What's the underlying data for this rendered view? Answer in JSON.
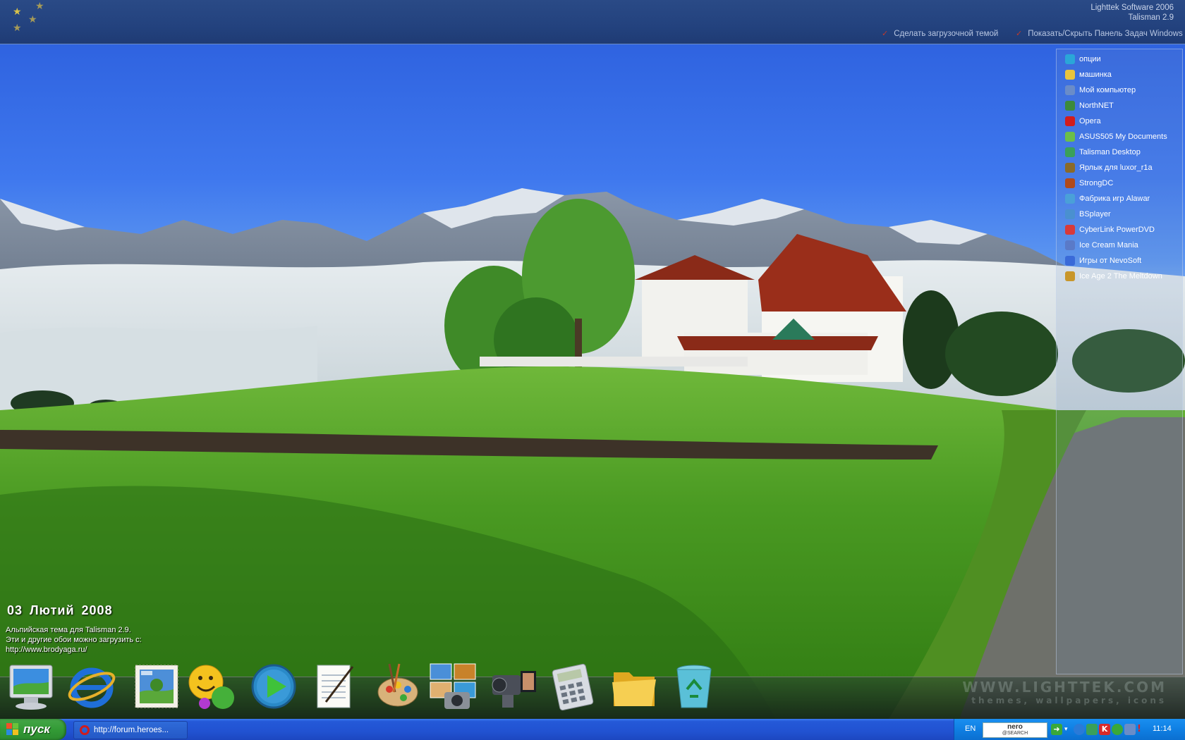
{
  "top_bar": {
    "brand_line1": "Lighttek Software 2006",
    "brand_line2": "Talisman 2.9",
    "link_boot_theme": "Сделать загрузочной темой",
    "link_toggle_taskbar": "Показать/Скрыть Панель Задач Windows"
  },
  "side_panel": {
    "items": [
      {
        "label": "опции",
        "icon": "play-arrow-icon",
        "color": "#2aa6d8"
      },
      {
        "label": "машинка",
        "icon": "folder-icon",
        "color": "#e9c43c"
      },
      {
        "label": "Мой компьютер",
        "icon": "computer-icon",
        "color": "#6a8cc8"
      },
      {
        "label": "NorthNET",
        "icon": "network-icon",
        "color": "#3c8a3c"
      },
      {
        "label": "Opera",
        "icon": "opera-icon",
        "color": "#d21c1c"
      },
      {
        "label": "ASUS505 My Documents",
        "icon": "documents-icon",
        "color": "#6bbf4a"
      },
      {
        "label": "Talisman Desktop",
        "icon": "talisman-icon",
        "color": "#3aa05a"
      },
      {
        "label": "Ярлык для luxor_r1a",
        "icon": "game-icon",
        "color": "#8a6a2a"
      },
      {
        "label": "StrongDC",
        "icon": "strongdc-icon",
        "color": "#b04a1a"
      },
      {
        "label": "Фабрика игр Alawar",
        "icon": "alawar-icon",
        "color": "#4aa0d8"
      },
      {
        "label": "BSplayer",
        "icon": "bsplayer-icon",
        "color": "#4a90d0"
      },
      {
        "label": "CyberLink PowerDVD",
        "icon": "powerdvd-icon",
        "color": "#d83a3a"
      },
      {
        "label": "Ice Cream Mania",
        "icon": "icecream-icon",
        "color": "#5a7ac8"
      },
      {
        "label": "Игры от NevoSoft",
        "icon": "nevosoft-icon",
        "color": "#3a6ad8"
      },
      {
        "label": "Ice Age 2 The Meltdown",
        "icon": "iceage-icon",
        "color": "#c8962a"
      }
    ]
  },
  "date": {
    "day": "03",
    "month": "Лютий",
    "year": "2008"
  },
  "info": {
    "line1": "Альпийская тема для Talisman 2.9.",
    "line2": "Эти и другие обои можно загрузить с:",
    "line3": "http://www.brodyaga.ru/"
  },
  "dock": {
    "watermark_line1": "WWW.LIGHTTEK.COM",
    "watermark_line2": "themes, wallpapers, icons",
    "icons": [
      "monitor-icon",
      "internet-explorer-icon",
      "postage-stamp-icon",
      "smiley-messenger-icon",
      "media-play-icon",
      "notepad-icon",
      "paint-palette-icon",
      "photo-camera-icon",
      "video-camera-icon",
      "calculator-icon",
      "folder-icon",
      "recycle-bin-icon"
    ]
  },
  "taskbar": {
    "start_label": "пуск",
    "task_item": "http://forum.heroes...",
    "lang": "EN",
    "nero_line1": "nero",
    "nero_line2": "@SEARCH",
    "clock": "11:14"
  }
}
